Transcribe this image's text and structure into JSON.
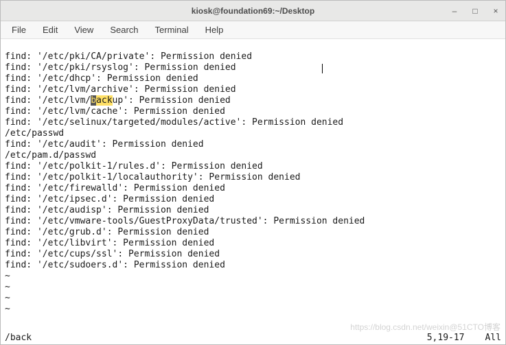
{
  "titlebar": {
    "title": "kiosk@foundation69:~/Desktop"
  },
  "menu": {
    "file": "File",
    "edit": "Edit",
    "view": "View",
    "search": "Search",
    "terminal": "Terminal",
    "help": "Help"
  },
  "terminal_lines": {
    "l0": "find: '/etc/pki/CA/private': Permission denied",
    "l1": "find: '/etc/pki/rsyslog': Permission denied",
    "l2": "find: '/etc/dhcp': Permission denied",
    "l3": "find: '/etc/lvm/archive': Permission denied",
    "l4a": "find: '/etc/lvm/",
    "l4hl1": "b",
    "l4hl2": "ack",
    "l4b": "up': Permission denied",
    "l5": "find: '/etc/lvm/cache': Permission denied",
    "l6": "find: '/etc/selinux/targeted/modules/active': Permission denied",
    "l7": "/etc/passwd",
    "l8": "find: '/etc/audit': Permission denied",
    "l9": "/etc/pam.d/passwd",
    "l10": "find: '/etc/polkit-1/rules.d': Permission denied",
    "l11": "find: '/etc/polkit-1/localauthority': Permission denied",
    "l12": "find: '/etc/firewalld': Permission denied",
    "l13": "find: '/etc/ipsec.d': Permission denied",
    "l14": "find: '/etc/audisp': Permission denied",
    "l15": "find: '/etc/vmware-tools/GuestProxyData/trusted': Permission denied",
    "l16": "find: '/etc/grub.d': Permission denied",
    "l17": "find: '/etc/libvirt': Permission denied",
    "l18": "find: '/etc/cups/ssl': Permission denied",
    "l19": "find: '/etc/sudoers.d': Permission denied",
    "tilde": "~"
  },
  "status": {
    "cmd": "/back",
    "pos": "5,19-17",
    "scroll": "All"
  },
  "watermark": "https://blog.csdn.net/weixin@51CTO博客"
}
